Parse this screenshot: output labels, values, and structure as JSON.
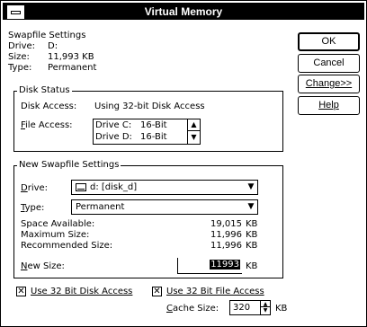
{
  "window": {
    "title": "Virtual Memory"
  },
  "swapfile": {
    "heading": "Swapfile Settings",
    "drive_label": "Drive:",
    "drive_value": "D:",
    "size_label": "Size:",
    "size_value": "11,993 KB",
    "type_label": "Type:",
    "type_value": "Permanent"
  },
  "disk_status": {
    "group_title": "Disk Status",
    "disk_access_label": "Disk Access:",
    "disk_access_value": "Using 32-bit Disk Access",
    "file_access_label": "File Access:",
    "file_access_list": [
      {
        "drive": "Drive C:",
        "mode": "16-Bit"
      },
      {
        "drive": "Drive D:",
        "mode": "16-Bit"
      }
    ]
  },
  "new_settings": {
    "group_title": "New Swapfile Settings",
    "drive_label": "Drive:",
    "drive_value": "d: [disk_d]",
    "type_label": "Type:",
    "type_value": "Permanent",
    "space_available_label": "Space Available:",
    "space_available_value": "19,015",
    "maximum_size_label": "Maximum Size:",
    "maximum_size_value": "11,996",
    "recommended_size_label": "Recommended Size:",
    "recommended_size_value": "11,996",
    "unit": "KB",
    "new_size_label": "New Size:",
    "new_size_value": "11993",
    "new_size_unit": "KB"
  },
  "options": {
    "use_32bit_disk_access_label": "Use 32 Bit Disk Access",
    "use_32bit_disk_access_checked": true,
    "use_32bit_file_access_label": "Use 32 Bit File Access",
    "use_32bit_file_access_checked": true,
    "cache_size_label": "Cache Size:",
    "cache_size_value": "320",
    "cache_size_unit": "KB"
  },
  "buttons": {
    "ok": "OK",
    "cancel": "Cancel",
    "change": "Change>>",
    "help": "Help"
  },
  "icons": {
    "combo_arrow": "down-arrow-icon",
    "drive_icon": "drive-icon"
  }
}
